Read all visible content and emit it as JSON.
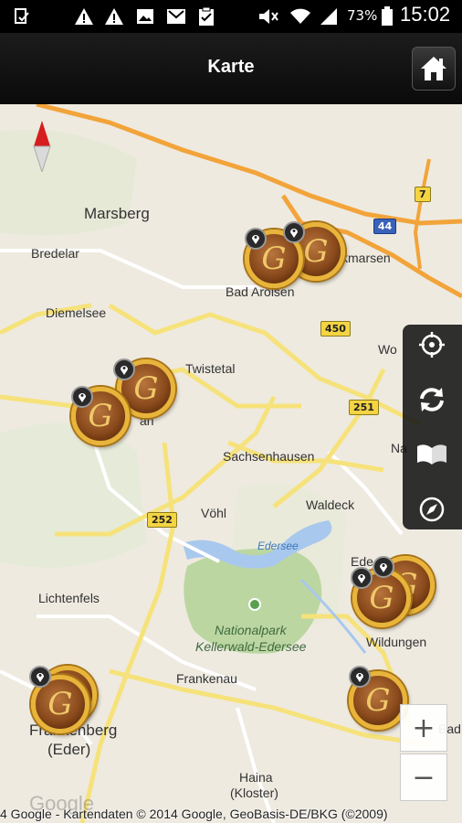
{
  "status_bar": {
    "icons": [
      "download-done-icon",
      "warning-icon",
      "warning-icon",
      "image-icon",
      "gmail-icon",
      "clipboard-check-icon",
      "mute-icon",
      "wifi-icon",
      "signal-icon",
      "battery-icon"
    ],
    "battery_percent": "73%",
    "clock": "15:02"
  },
  "header": {
    "title": "Karte",
    "home_icon": "home-icon"
  },
  "map": {
    "places": {
      "marsberg": "Marsberg",
      "bredelar": "Bredelar",
      "diemelsee": "Diemelsee",
      "bad_arolsen": "Bad Arolsen",
      "volkmarsen": "kmarsen",
      "twistetal": "Twistetal",
      "sachsenhausen": "Sachsenhausen",
      "voehl": "Vöhl",
      "waldeck": "Waldeck",
      "edersee": "Edersee",
      "lichtenfels": "Lichtenfels",
      "nationalpark": "Nationalpark",
      "kellerwald": "Kellerwald-Edersee",
      "frankenau": "Frankenau",
      "frankenberg": "Frankenberg",
      "eder": "(Eder)",
      "haina": "Haina",
      "kloster": "(Kloster)",
      "wildungen": "Wildungen",
      "wolfhagen": "Wo",
      "naumburg": "Na",
      "bad_z": "Bad Z",
      "eder_town": "Ede",
      "korbach_partial": "an"
    },
    "road_shields": {
      "b7": "7",
      "a44": "44",
      "b450": "450",
      "b251": "251",
      "b252": "252"
    },
    "compass_icon": "north-arrow-icon",
    "attribution": "4 Google - Kartendaten © 2014 Google, GeoBasis-DE/BKG (©2009)",
    "watermark": "Google"
  },
  "toolbar": {
    "locate_icon": "crosshair-icon",
    "refresh_icon": "refresh-icon",
    "book_icon": "book-icon",
    "compass_icon": "compass-icon"
  },
  "zoom": {
    "zoom_in": "+",
    "zoom_out": "−"
  },
  "markers": {
    "coin_letter": "G",
    "pin_icon": "location-pin-icon"
  },
  "colors": {
    "header_bg": "#111111",
    "coin_rim": "#e8b43a",
    "coin_face": "#8a4a1c",
    "highway": "#f2a43a"
  }
}
